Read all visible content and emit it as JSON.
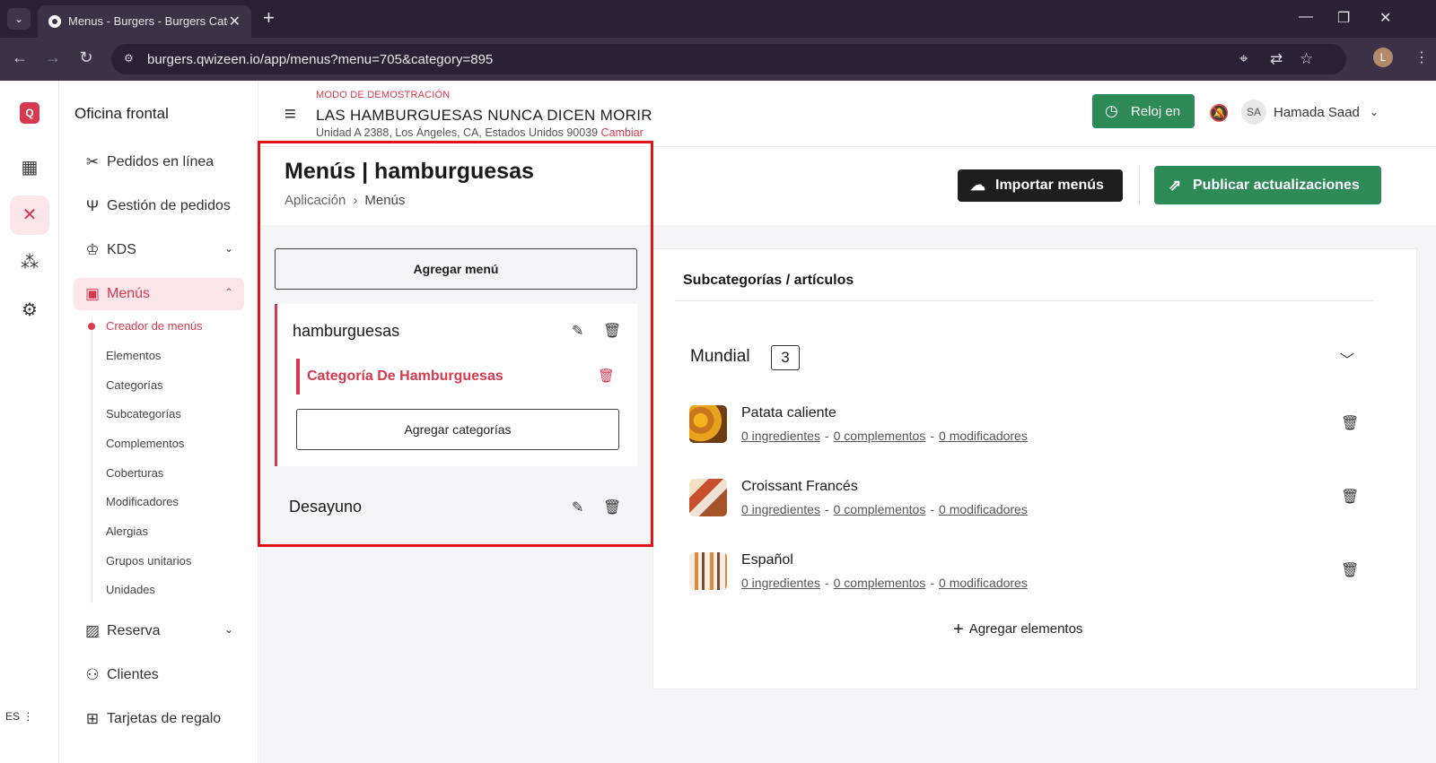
{
  "browser": {
    "tab_title": "Menus - Burgers - Burgers Cate",
    "url": "burgers.qwizeen.io/app/menus?menu=705&category=895",
    "profile_initial": "L"
  },
  "rail": {
    "language": "ES"
  },
  "sidebar": {
    "title": "Oficina frontal",
    "items": [
      {
        "label": "Pedidos en línea"
      },
      {
        "label": "Gestión de pedidos"
      },
      {
        "label": "KDS"
      },
      {
        "label": "Menús"
      },
      {
        "label": "Reserva"
      },
      {
        "label": "Clientes"
      },
      {
        "label": "Tarjetas de regalo"
      }
    ],
    "subitems": [
      {
        "label": "Creador de menús"
      },
      {
        "label": "Elementos"
      },
      {
        "label": "Categorías"
      },
      {
        "label": "Subcategorías"
      },
      {
        "label": "Complementos"
      },
      {
        "label": "Coberturas"
      },
      {
        "label": "Modificadores"
      },
      {
        "label": "Alergias"
      },
      {
        "label": "Grupos unitarios"
      },
      {
        "label": "Unidades"
      }
    ]
  },
  "topbar": {
    "demo_label": "MODO DE DEMOSTRACIÓN",
    "store_name": "LAS HAMBURGUESAS NUNCA DICEN MORIR",
    "address": "Unidad A 2388, Los Ángeles, CA, Estados Unidos 90039",
    "change_label": "Cambiar",
    "clock_label": "Reloj en",
    "user_initials": "SA",
    "user_name": "Hamada Saad"
  },
  "page": {
    "title": "Menús | hamburguesas",
    "breadcrumb": [
      "Aplicación",
      "Menús"
    ],
    "import_label": "Importar menús",
    "publish_label": "Publicar actualizaciones"
  },
  "menus": {
    "add_menu_label": "Agregar menú",
    "list": [
      {
        "name": "hamburguesas"
      },
      {
        "name": "Desayuno"
      }
    ],
    "active_category": "Categoría De Hamburguesas",
    "add_categories_label": "Agregar categorías"
  },
  "items_panel": {
    "header": "Subcategorías / artículos",
    "subcategory": {
      "name": "Mundial",
      "count": "3"
    },
    "links": {
      "ingredients": "0 ingredientes",
      "complements": "0 complementos",
      "modifiers": "0 modificadores"
    },
    "items": [
      {
        "name": "Patata caliente"
      },
      {
        "name": "Croissant Francés"
      },
      {
        "name": "Español"
      }
    ],
    "add_items_label": "Agregar elementos"
  },
  "colors": {
    "accent": "#d63a4e",
    "green": "#2e8a57",
    "highlight_outline": "#e2121b"
  }
}
